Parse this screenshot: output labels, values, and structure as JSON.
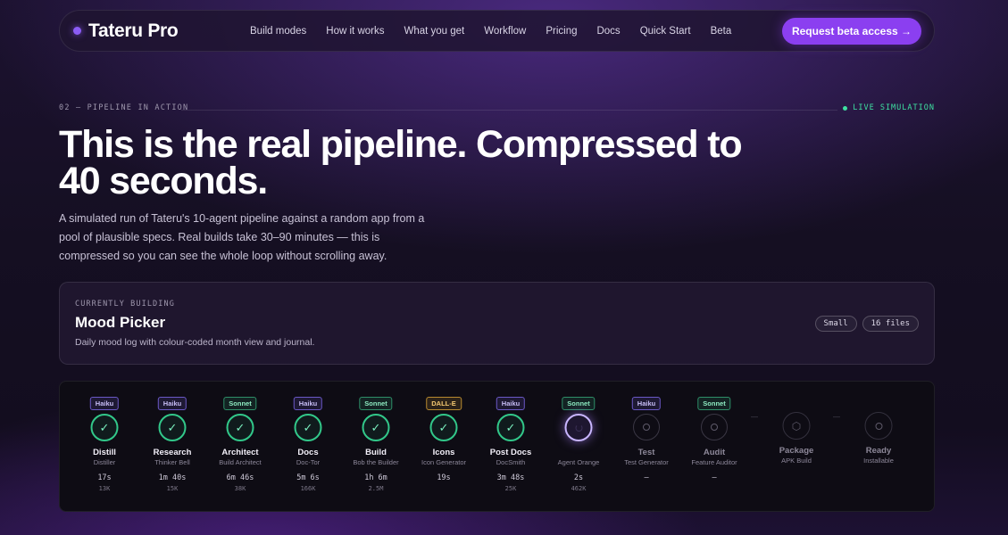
{
  "nav": {
    "brand": "Tateru Pro",
    "links": [
      "Build modes",
      "How it works",
      "What you get",
      "Workflow",
      "Pricing",
      "Docs",
      "Quick Start",
      "Beta"
    ],
    "cta": "Request beta access →"
  },
  "section": {
    "label": "02 — PIPELINE IN ACTION",
    "live": "LIVE SIMULATION",
    "headline": "This is the real pipeline. Compressed to 40 seconds.",
    "lede": "A simulated run of Tateru's 10-agent pipeline against a random app from a pool of plausible specs. Real builds take 30–90 minutes — this is compressed so you can see the whole loop without scrolling away."
  },
  "build": {
    "label": "CURRENTLY BUILDING",
    "title": "Mood Picker",
    "description": "Daily mood log with colour-coded month view and journal.",
    "chips": [
      "Small",
      "16 files"
    ]
  },
  "pipeline": {
    "stages": [
      {
        "model": "Haiku",
        "name": "Distill",
        "agent": "Distiller",
        "time": "17s",
        "tokens": "13K",
        "state": "done"
      },
      {
        "model": "Haiku",
        "name": "Research",
        "agent": "Thinker Bell",
        "time": "1m 40s",
        "tokens": "15K",
        "state": "done"
      },
      {
        "model": "Sonnet",
        "name": "Architect",
        "agent": "Build Architect",
        "time": "6m 46s",
        "tokens": "38K",
        "state": "done"
      },
      {
        "model": "Haiku",
        "name": "Docs",
        "agent": "Doc-Tor",
        "time": "5m 6s",
        "tokens": "166K",
        "state": "done"
      },
      {
        "model": "Sonnet",
        "name": "Build",
        "agent": "Bob the Builder",
        "time": "1h 6m",
        "tokens": "2.5M",
        "state": "done"
      },
      {
        "model": "DALL-E",
        "name": "Icons",
        "agent": "Icon Generator",
        "time": "19s",
        "tokens": "",
        "state": "done"
      },
      {
        "model": "Haiku",
        "name": "Post Docs",
        "agent": "DocSmith",
        "time": "3m 48s",
        "tokens": "25K",
        "state": "done"
      },
      {
        "model": "Sonnet",
        "name": "",
        "agent": "Agent Orange",
        "time": "2s",
        "tokens": "462K",
        "state": "active"
      },
      {
        "model": "Haiku",
        "name": "Test",
        "agent": "Test Generator",
        "time": "—",
        "tokens": "",
        "state": "pending"
      },
      {
        "model": "Sonnet",
        "name": "Audit",
        "agent": "Feature Auditor",
        "time": "—",
        "tokens": "",
        "state": "pending"
      },
      {
        "model": "",
        "name": "Package",
        "agent": "APK Build",
        "time": "",
        "tokens": "",
        "state": "package"
      },
      {
        "model": "",
        "name": "Ready",
        "agent": "Installable",
        "time": "",
        "tokens": "",
        "state": "ready"
      }
    ],
    "separator": "—"
  },
  "colors": {
    "accent": "#8b3ff0",
    "success": "#32c88a",
    "live": "#3ee0a1"
  }
}
